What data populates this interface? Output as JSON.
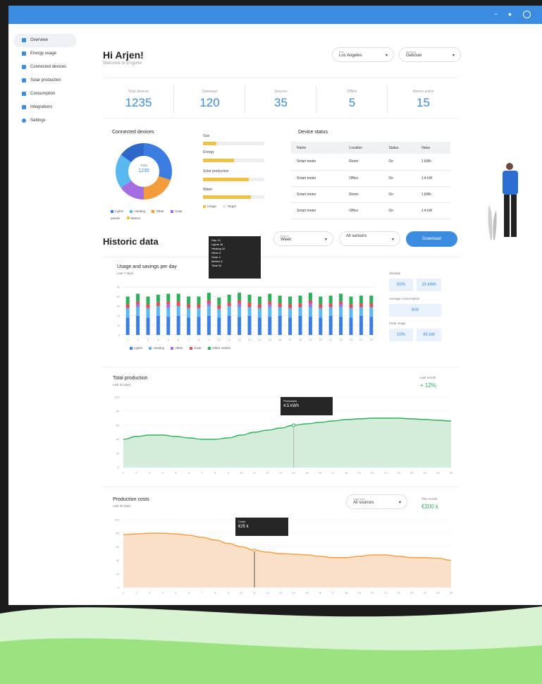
{
  "topbar": {
    "icons": [
      "minus-icon",
      "drop-icon",
      "user-circle-icon"
    ],
    "color": "#3b8ce0"
  },
  "sidebar": {
    "items": [
      {
        "label": "Overview",
        "icon": "home-icon"
      },
      {
        "label": "Energy usage",
        "icon": "bar-chart-icon"
      },
      {
        "label": "Connected devices",
        "icon": "grid-icon"
      },
      {
        "label": "Solar production",
        "icon": "solar-icon"
      },
      {
        "label": "Consumption",
        "icon": "bolt-icon"
      },
      {
        "label": "Integrations",
        "icon": "plug-icon"
      },
      {
        "label": "Settings",
        "icon": "gear-icon"
      }
    ]
  },
  "header": {
    "greeting": "Hi Arjen!",
    "subtitle": "Welcome to Engynie"
  },
  "filters": [
    {
      "label": "Site",
      "value": "Los Angeles"
    },
    {
      "label": "Building",
      "value": "Gebouw"
    }
  ],
  "stats": [
    {
      "label": "Total devices",
      "value": "1235"
    },
    {
      "label": "Gateways",
      "value": "120"
    },
    {
      "label": "Sensors",
      "value": "35"
    },
    {
      "label": "Offline",
      "value": "5"
    },
    {
      "label": "Alarms active",
      "value": "15"
    }
  ],
  "donut": {
    "title": "Connected devices",
    "center_label": "Total",
    "center_value": "1235",
    "slices": [
      {
        "name": "Lights",
        "value": 30,
        "color": "#3b7de0"
      },
      {
        "name": "Heating",
        "value": 20,
        "color": "#f39c3c"
      },
      {
        "name": "Other",
        "value": 15,
        "color": "#a56ee0"
      },
      {
        "name": "Sensors",
        "value": 20,
        "color": "#5ab8f0"
      },
      {
        "name": "Meters",
        "value": 15,
        "color": "#2f67c9"
      }
    ],
    "legend": [
      "Lights",
      "Heating",
      "Other",
      "Solar panels",
      "Meters"
    ],
    "legend_colors": [
      "#3b7de0",
      "#5ab8f0",
      "#f39c3c",
      "#a56ee0",
      "#f3c244"
    ]
  },
  "bars": {
    "items": [
      {
        "label": "Gas",
        "fill": 0.22
      },
      {
        "label": "Energy",
        "fill": 0.5
      },
      {
        "label": "Solar production",
        "fill": 0.75
      },
      {
        "label": "Water",
        "fill": 0.78
      }
    ],
    "legend": [
      "Usage",
      "Target"
    ]
  },
  "devices": {
    "title": "Device status",
    "columns": [
      "Name",
      "Location",
      "Status",
      "Value"
    ],
    "rows": [
      [
        "Smart meter",
        "Room",
        "On",
        "1 kWh"
      ],
      [
        "Smart meter",
        "Office",
        "On",
        "1.4 kW"
      ],
      [
        "Smart meter",
        "Room",
        "On",
        "1 kWh"
      ],
      [
        "Smart meter",
        "Office",
        "On",
        "1.4 kW"
      ]
    ]
  },
  "history": {
    "title": "Historic data",
    "filters": [
      {
        "label": "Period",
        "value": "Week"
      },
      {
        "label": "",
        "value": "All sensors"
      }
    ],
    "apply": "Download"
  },
  "chart_data": [
    {
      "type": "bar",
      "title": "Usage and savings per day",
      "subtitle": "Last 7 days",
      "categories": [
        "1",
        "2",
        "3",
        "4",
        "5",
        "6",
        "7",
        "8",
        "9",
        "10",
        "11",
        "12",
        "13",
        "14",
        "15",
        "16",
        "17",
        "18",
        "19",
        "20",
        "21",
        "22",
        "23",
        "24",
        "25"
      ],
      "series": [
        {
          "name": "Lights",
          "color": "#3b7de0",
          "values": [
            18,
            20,
            18,
            20,
            19,
            20,
            18,
            19,
            20,
            18,
            20,
            19,
            20,
            18,
            19,
            20,
            18,
            20,
            19,
            18,
            20,
            19,
            18,
            20,
            19
          ]
        },
        {
          "name": "Heating",
          "color": "#5ab8f0",
          "values": [
            10,
            9,
            10,
            10,
            9,
            10,
            10,
            9,
            10,
            9,
            10,
            10,
            9,
            10,
            10,
            9,
            10,
            9,
            10,
            10,
            9,
            10,
            10,
            9,
            10
          ]
        },
        {
          "name": "Other",
          "color": "#a56ee0",
          "values": [
            0,
            3,
            0,
            0,
            4,
            0,
            0,
            0,
            3,
            0,
            0,
            4,
            0,
            0,
            3,
            0,
            0,
            0,
            4,
            0,
            0,
            3,
            0,
            0,
            0
          ]
        },
        {
          "name": "Solar",
          "color": "#e04e5a",
          "values": [
            4,
            3,
            4,
            4,
            3,
            5,
            4,
            4,
            3,
            4,
            4,
            3,
            5,
            4,
            3,
            4,
            4,
            4,
            3,
            4,
            4,
            3,
            4,
            4,
            4
          ]
        },
        {
          "name": "Other meters",
          "color": "#2fae5a",
          "values": [
            8,
            8,
            8,
            8,
            8,
            8,
            8,
            8,
            8,
            8,
            8,
            8,
            8,
            8,
            8,
            8,
            8,
            8,
            8,
            8,
            8,
            8,
            8,
            8,
            8
          ]
        }
      ],
      "legend": [
        "Lights",
        "Heating",
        "Other",
        "Solar",
        "Other meters"
      ],
      "ylim": [
        0,
        50
      ],
      "tooltip": [
        "Day 14",
        "Lights 18",
        "Heating 10",
        "Other 0",
        "Solar 4",
        "Meters 8",
        "Total 40"
      ],
      "side_stats": [
        {
          "label": "Savings",
          "values": [
            "50%",
            "10 kWh"
          ]
        },
        {
          "label": "Average consumption",
          "values": [
            "600"
          ]
        },
        {
          "label": "Peak usage",
          "values": [
            "10%",
            "45 kW"
          ]
        }
      ]
    },
    {
      "type": "area",
      "title": "Total production",
      "subtitle": "Last 30 days",
      "color": "#2fae5a",
      "fill": "#d4ecda",
      "x": [
        1,
        2,
        3,
        4,
        5,
        6,
        7,
        8,
        9,
        10,
        11,
        12,
        13,
        14,
        15,
        16,
        17,
        18,
        19,
        20,
        21,
        22,
        23,
        24,
        25,
        26
      ],
      "y": [
        40,
        44,
        46,
        46,
        44,
        42,
        40,
        40,
        42,
        46,
        50,
        53,
        56,
        60,
        62,
        64,
        66,
        68,
        69,
        70,
        70,
        70,
        69,
        68,
        67,
        66
      ],
      "ylim": [
        0,
        100
      ],
      "tooltip": [
        "Production",
        "4.5 kWh"
      ],
      "summary_label": "Last month",
      "summary_value": "+ 12%"
    },
    {
      "type": "area",
      "title": "Production costs",
      "subtitle": "Last 30 days",
      "color": "#f39c3c",
      "fill": "#fae0c8",
      "x": [
        1,
        2,
        3,
        4,
        5,
        6,
        7,
        8,
        9,
        10,
        11,
        12,
        13,
        14,
        15,
        16,
        17,
        18,
        19,
        20,
        21,
        22,
        23,
        24,
        25,
        26
      ],
      "y": [
        78,
        79,
        80,
        80,
        79,
        77,
        74,
        70,
        65,
        60,
        55,
        52,
        50,
        49,
        48,
        46,
        44,
        44,
        46,
        48,
        48,
        46,
        44,
        44,
        43,
        40
      ],
      "ylim": [
        0,
        100
      ],
      "tooltip": [
        "Costs",
        "€25 k"
      ],
      "filter": {
        "label": "Data type",
        "value": "All sources"
      },
      "summary_label": "This month",
      "summary_value": "€200 k"
    }
  ]
}
